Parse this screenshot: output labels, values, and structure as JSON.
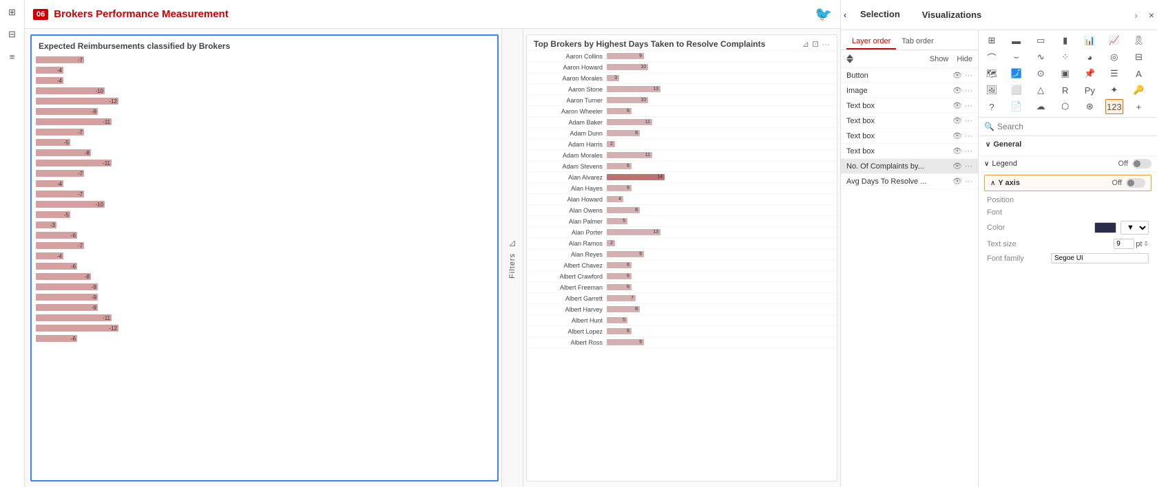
{
  "app": {
    "title": "Brokers Performance Measurement",
    "badge": "06"
  },
  "leftSidebar": {
    "icons": [
      "grid-4",
      "grid-2",
      "list"
    ]
  },
  "chartLeft": {
    "title": "Expected Reimbursements classified by Brokers",
    "bars": [
      {
        "value": -7
      },
      {
        "value": -4
      },
      {
        "value": -4
      },
      {
        "value": -10
      },
      {
        "value": -12
      },
      {
        "value": -9
      },
      {
        "value": -11
      },
      {
        "value": -7
      },
      {
        "value": -5
      },
      {
        "value": -8
      },
      {
        "value": -11
      },
      {
        "value": -7
      },
      {
        "value": -4
      },
      {
        "value": -7
      },
      {
        "value": -10
      },
      {
        "value": -5
      },
      {
        "value": -3
      },
      {
        "value": -6
      },
      {
        "value": -7
      },
      {
        "value": -4
      },
      {
        "value": -6
      },
      {
        "value": -8
      },
      {
        "value": -9
      },
      {
        "value": -9
      },
      {
        "value": -9
      },
      {
        "value": -11
      },
      {
        "value": -12
      },
      {
        "value": -6
      }
    ]
  },
  "chartRight": {
    "title": "Top Brokers by Highest Days Taken to Resolve Complaints",
    "brokers": [
      {
        "name": "Aaron Collins",
        "value": 9
      },
      {
        "name": "Aaron Howard",
        "value": 10
      },
      {
        "name": "Aaron Morales",
        "value": 3
      },
      {
        "name": "Aaron Stone",
        "value": 13
      },
      {
        "name": "Aaron Turner",
        "value": 10
      },
      {
        "name": "Aaron Wheeler",
        "value": 6
      },
      {
        "name": "Adam Baker",
        "value": 11
      },
      {
        "name": "Adam Dunn",
        "value": 8
      },
      {
        "name": "Adam Harris",
        "value": 2
      },
      {
        "name": "Adam Morales",
        "value": 11
      },
      {
        "name": "Adam Stevens",
        "value": 6
      },
      {
        "name": "Alan Alvarez",
        "value": 14
      },
      {
        "name": "Alan Hayes",
        "value": 6
      },
      {
        "name": "Alan Howard",
        "value": 4
      },
      {
        "name": "Alan Owens",
        "value": 8
      },
      {
        "name": "Alan Palmer",
        "value": 5
      },
      {
        "name": "Alan Porter",
        "value": 13
      },
      {
        "name": "Alan Ramos",
        "value": 2
      },
      {
        "name": "Alan Reyes",
        "value": 9
      },
      {
        "name": "Albert Chavez",
        "value": 6
      },
      {
        "name": "Albert Crawford",
        "value": 6
      },
      {
        "name": "Albert Freeman",
        "value": 6
      },
      {
        "name": "Albert Garrett",
        "value": 7
      },
      {
        "name": "Albert Harvey",
        "value": 8
      },
      {
        "name": "Albert Hunt",
        "value": 5
      },
      {
        "name": "Albert Lopez",
        "value": 6
      },
      {
        "name": "Albert Ross",
        "value": 9
      }
    ]
  },
  "filters": {
    "label": "Filters"
  },
  "selectionPanel": {
    "title": "Selection",
    "closeLabel": "×",
    "navBack": "‹",
    "navForward": "›"
  },
  "visualizationsPanel": {
    "title": "Visualizations"
  },
  "layerPanel": {
    "tabs": [
      {
        "label": "Layer order",
        "active": true
      },
      {
        "label": "Tab order",
        "active": false
      }
    ],
    "showLabel": "Show",
    "hideLabel": "Hide",
    "items": [
      {
        "label": "Button"
      },
      {
        "label": "Image"
      },
      {
        "label": "Text box"
      },
      {
        "label": "Text box"
      },
      {
        "label": "Text box"
      },
      {
        "label": "Text box"
      },
      {
        "label": "No. Of Complaints by..."
      },
      {
        "label": "Avg Days To Resolve ..."
      }
    ]
  },
  "vizPanel": {
    "searchPlaceholder": "Search",
    "searchLabel": "Search",
    "icons": [
      "table",
      "bar-chart",
      "stacked-bar",
      "clustered-bar",
      "waterfall",
      "funnel",
      "scatter",
      "line",
      "area",
      "combo",
      "ribbon",
      "pie",
      "donut",
      "treemap",
      "map",
      "filled-map",
      "gauge",
      "card",
      "kpi",
      "slicer",
      "text",
      "image",
      "button",
      "shape",
      "r-visual",
      "python-visual",
      "decomp",
      "key-inf",
      "qa",
      "paginated",
      "azure",
      "power-apps",
      "power-automate",
      "custom1",
      "custom2",
      "custom3"
    ],
    "sections": {
      "general": {
        "label": "General",
        "expanded": true
      },
      "legend": {
        "label": "Legend",
        "value": "Off",
        "toggled": false
      },
      "yAxis": {
        "label": "Y axis",
        "value": "Off",
        "toggled": false,
        "highlighted": true
      }
    },
    "properties": {
      "position": "Position",
      "font": "Font",
      "color": "Color",
      "textSize": "Text size",
      "textSizeValue": "9",
      "textSizeUnit": "pt",
      "fontFamily": "Font family",
      "fontFamilyValue": "Segoe UI"
    }
  }
}
